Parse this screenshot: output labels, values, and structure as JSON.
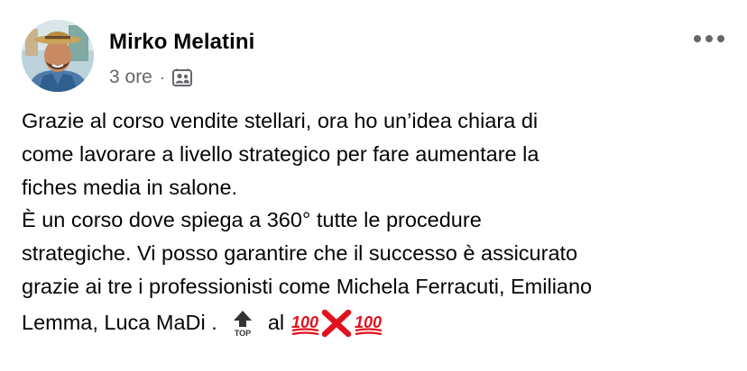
{
  "post": {
    "author": "Mirko Melatini",
    "time": "3 ore",
    "separator": "·",
    "audience_icon": "friends-of-friends-icon",
    "more_icon": "more-horizontal-icon",
    "text_lines": [
      "Grazie al corso vendite stellari, ora ho un’idea chiara di",
      "come lavorare a livello strategico per fare aumentare la",
      "fiches media in salone.",
      "È un corso dove spiega a 360° tutte le procedure",
      "strategiche. Vi posso garantire che il successo è assicurato",
      "grazie ai tre i professionisti come Michela Ferracuti, Emiliano"
    ],
    "last_line_prefix": "Lemma, Luca MaDi .",
    "last_line_al": "al",
    "emoji": [
      "top-arrow-icon",
      "hundred-points-icon",
      "cross-mark-icon",
      "hundred-points-icon"
    ]
  },
  "colors": {
    "text": "#050505",
    "secondary": "#65676b",
    "emoji_red": "#e0121e"
  }
}
